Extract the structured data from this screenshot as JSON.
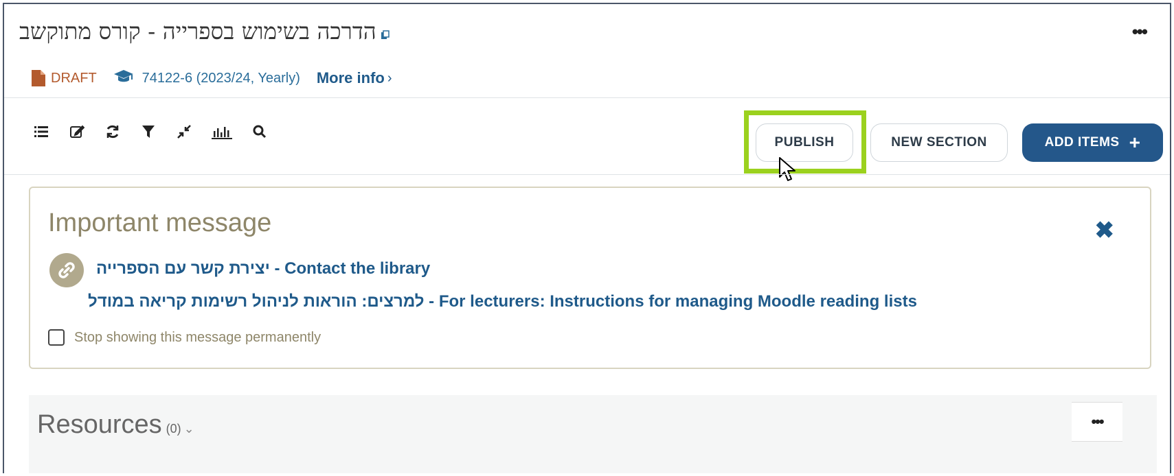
{
  "header": {
    "course_title": "הדרכה בשימוש בספרייה - קורס מתוקשב",
    "status": "DRAFT",
    "course_code": "74122-6 (2023/24, Yearly)",
    "more_info_label": "More info",
    "more_info_chevron": "›",
    "menu_label": "•••"
  },
  "toolbar": {
    "icons": [
      "list-icon",
      "edit-icon",
      "refresh-icon",
      "filter-icon",
      "collapse-icon",
      "analytics-icon",
      "search-icon"
    ],
    "publish_label": "PUBLISH",
    "new_section_label": "NEW SECTION",
    "add_items_label": "ADD ITEMS",
    "add_items_icon": "+"
  },
  "message": {
    "title": "Important message",
    "close_icon": "✖",
    "links": [
      "יצירת קשר עם הספרייה - Contact the library",
      "למרצים: הוראות לניהול רשימות קריאה במודל - For lecturers: Instructions for managing Moodle reading lists"
    ],
    "checkbox_label": "Stop showing this message permanently"
  },
  "resources": {
    "title": "Resources",
    "count": "(0)",
    "chevron": "⌄",
    "menu_label": "•••"
  },
  "colors": {
    "accent": "#24578a",
    "link": "#1f5a8a",
    "draft": "#b35a2d",
    "highlight": "#9bd11e",
    "message_text": "#8e8669"
  }
}
